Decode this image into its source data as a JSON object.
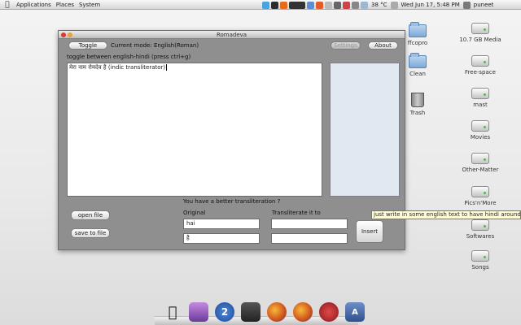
{
  "top_panel": {
    "menus": [
      "Applications",
      "Places",
      "System"
    ],
    "temperature": "38 °C",
    "datetime": "Wed Jun 17,  5:48 PM",
    "user": "puneet"
  },
  "desktop_icons": [
    {
      "label": "ffcopro",
      "type": "folder"
    },
    {
      "label": "Clean",
      "type": "folder"
    },
    {
      "label": "Trash",
      "type": "trash"
    },
    {
      "label": "10.7 GB Media",
      "type": "drive"
    },
    {
      "label": "Free-space",
      "type": "drive"
    },
    {
      "label": "mast",
      "type": "drive"
    },
    {
      "label": "Movies",
      "type": "drive"
    },
    {
      "label": "Other-Matter",
      "type": "drive"
    },
    {
      "label": "Pics'n'More",
      "type": "drive"
    },
    {
      "label": "Softwares",
      "type": "drive"
    },
    {
      "label": "Songs",
      "type": "drive"
    }
  ],
  "window": {
    "title": "Romadeva",
    "toggle_label": "Toggle",
    "current_mode": "Current mode: English(Roman)",
    "settings_label": "Settings",
    "about_label": "About",
    "hint": "toggle between english-hindi (press ctrl+g)",
    "editor_text": "मेरा नाम रोमदेव है (indic transliterator)",
    "open_file_label": "open file",
    "save_file_label": "save to file",
    "better_prompt": "You have a better transliteration ?",
    "original_label": "Original",
    "transliterate_label": "Transliterate it to",
    "original_value": "hai",
    "original_hindi": "है",
    "transliterate_value": "",
    "transliterate_value2": "",
    "insert_label": "Insert"
  },
  "tooltip": "just write in some english text to have hindi around you!",
  "colors": {
    "window_bg": "#8f8f8f",
    "side_panel": "#e2e8f1",
    "tooltip_bg": "#fffed8"
  }
}
